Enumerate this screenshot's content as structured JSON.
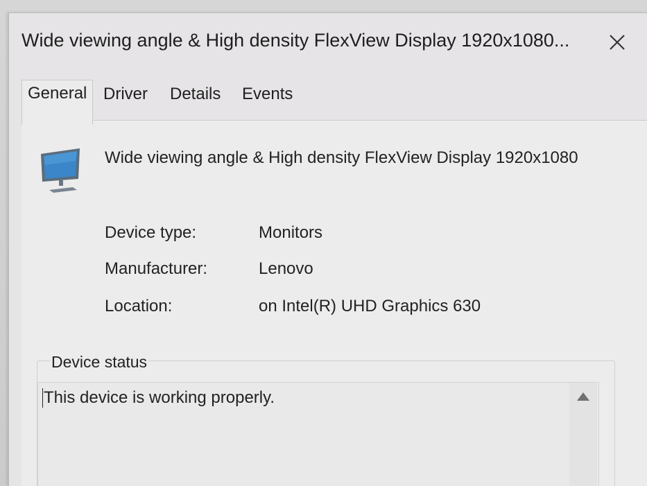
{
  "window": {
    "title": "Wide viewing angle & High density FlexView Display 1920x1080..."
  },
  "tabs": [
    {
      "label": "General",
      "active": true
    },
    {
      "label": "Driver",
      "active": false
    },
    {
      "label": "Details",
      "active": false
    },
    {
      "label": "Events",
      "active": false
    }
  ],
  "device": {
    "name": "Wide viewing angle & High density FlexView Display 1920x1080",
    "icon": "monitor-icon",
    "properties": [
      {
        "label": "Device type:",
        "value": "Monitors"
      },
      {
        "label": "Manufacturer:",
        "value": "Lenovo"
      },
      {
        "label": "Location:",
        "value": "on Intel(R) UHD Graphics 630"
      }
    ]
  },
  "status": {
    "legend": "Device status",
    "text": "This device is working properly."
  },
  "colors": {
    "window_bg": "#e6e4e6",
    "panel_bg": "#ececec",
    "monitor_screen": "#3a86c8",
    "monitor_frame": "#5a6a7a"
  }
}
